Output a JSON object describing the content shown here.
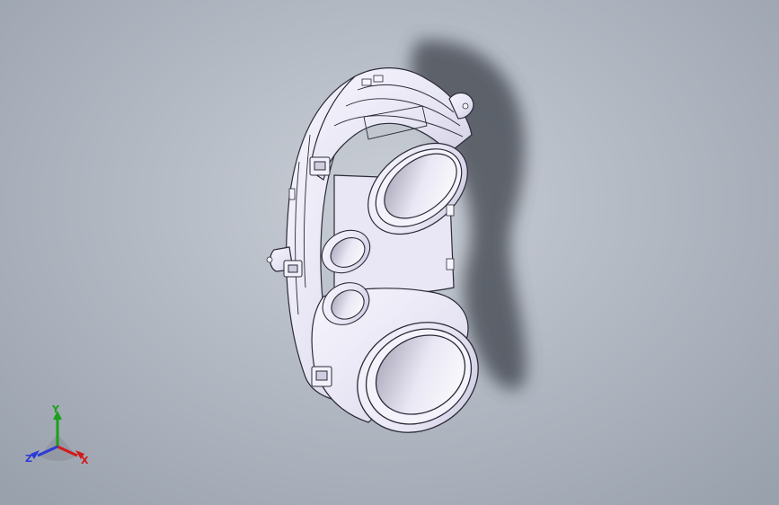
{
  "viewport": {
    "background_top": "#c9ced6",
    "background_bottom": "#99a1ad",
    "model_face_color": "#eceaf6",
    "model_edge_color": "#2a2a38",
    "shadow_color": "#3e434c"
  },
  "triad": {
    "x_label": "X",
    "y_label": "Y",
    "z_label": "Z",
    "x_color": "#d31a1a",
    "y_color": "#1aa01a",
    "z_color": "#2a3bd8"
  }
}
